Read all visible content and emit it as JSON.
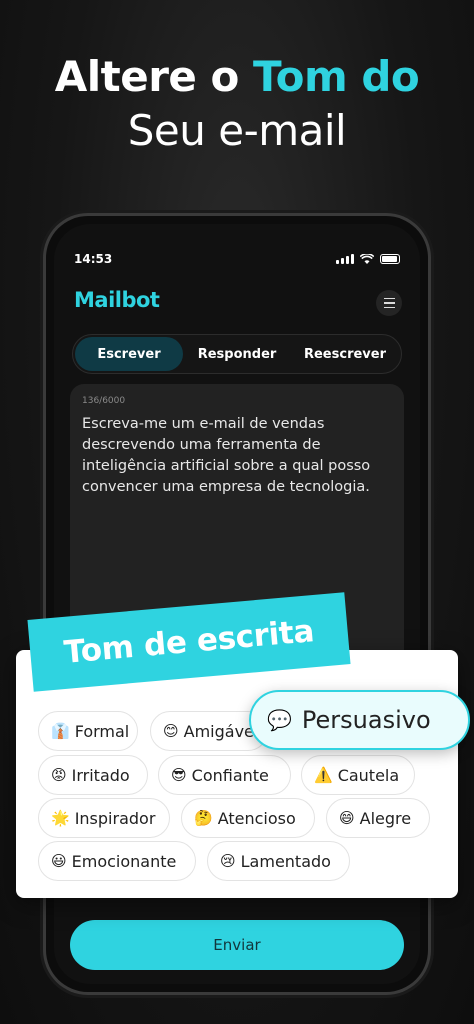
{
  "headline": {
    "line1_part1": "Altere ",
    "line1_part2": "o ",
    "line1_part3": "Tom do",
    "line2": "Seu e-mail"
  },
  "status_bar": {
    "time": "14:53"
  },
  "app": {
    "name": "Mailbot"
  },
  "tabs": [
    {
      "label": "Escrever",
      "active": true
    },
    {
      "label": "Responder",
      "active": false
    },
    {
      "label": "Reescrever",
      "active": false
    }
  ],
  "editor": {
    "counter": "136/6000",
    "text": "Escreva-me um e-mail de vendas descrevendo uma ferramenta de inteligência artificial sobre a qual posso convencer uma empresa de tecnologia."
  },
  "tone_panel": {
    "title": "Tom de escrita",
    "selected": {
      "emoji": "💬",
      "label": "Persuasivo"
    },
    "options": [
      {
        "emoji": "👔",
        "label": "Formal"
      },
      {
        "emoji": "😊",
        "label": "Amigáve"
      },
      {
        "emoji": "😡",
        "label": "Irritado"
      },
      {
        "emoji": "😎",
        "label": "Confiante"
      },
      {
        "emoji": "⚠️",
        "label": "Cautela"
      },
      {
        "emoji": "🌟",
        "label": "Inspirador"
      },
      {
        "emoji": "🤔",
        "label": "Atencioso"
      },
      {
        "emoji": "😄",
        "label": "Alegre"
      },
      {
        "emoji": "😃",
        "label": "Emocionante"
      },
      {
        "emoji": "😢",
        "label": "Lamentado"
      }
    ]
  },
  "send_button": {
    "label": "Enviar"
  },
  "colors": {
    "accent": "#2fd3e0",
    "background": "#161616",
    "active_tab": "#0f3a45",
    "editor_bg": "#222222"
  }
}
